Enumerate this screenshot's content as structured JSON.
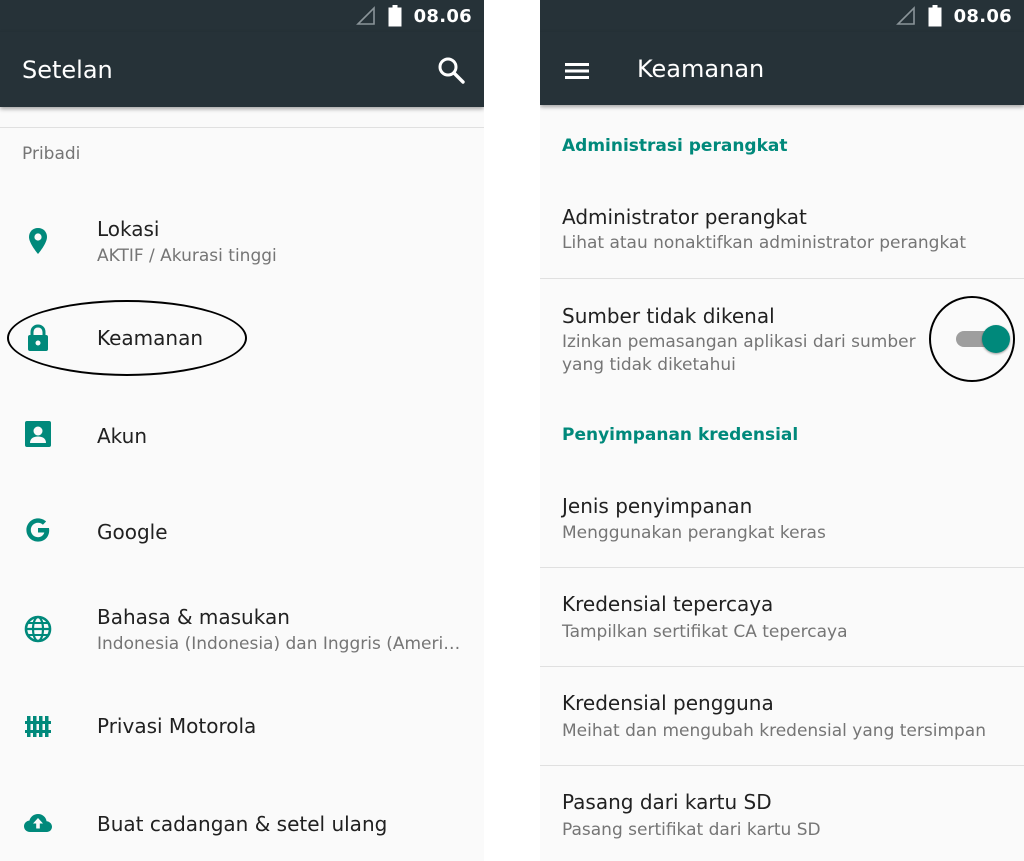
{
  "status_bar": {
    "time": "08.06",
    "icons": [
      "signal-icon",
      "battery-icon"
    ]
  },
  "left": {
    "title": "Setelan",
    "section_header": "Pribadi",
    "items": [
      {
        "icon": "location-icon",
        "title": "Lokasi",
        "subtitle": "AKTIF / Akurasi tinggi"
      },
      {
        "icon": "lock-icon",
        "title": "Keamanan"
      },
      {
        "icon": "account-icon",
        "title": "Akun"
      },
      {
        "icon": "google-icon",
        "title": "Google"
      },
      {
        "icon": "globe-icon",
        "title": "Bahasa & masukan",
        "subtitle": "Indonesia (Indonesia) dan Inggris (Amerika Serikat)"
      },
      {
        "icon": "fence-icon",
        "title": "Privasi Motorola"
      },
      {
        "icon": "cloud-upload-icon",
        "title": "Buat cadangan & setel ulang"
      }
    ]
  },
  "right": {
    "title": "Keamanan",
    "sections": [
      {
        "header": "Administrasi perangkat"
      },
      {
        "header": "Penyimpanan kredensial"
      }
    ],
    "items": [
      {
        "title": "Administrator perangkat",
        "subtitle": "Lihat atau nonaktifkan administrator perangkat"
      },
      {
        "title": "Sumber tidak dikenal",
        "subtitle": "Izinkan pemasangan aplikasi dari sumber yang tidak diketahui",
        "toggle_on": true
      },
      {
        "title": "Jenis penyimpanan",
        "subtitle": "Menggunakan perangkat keras"
      },
      {
        "title": "Kredensial tepercaya",
        "subtitle": "Tampilkan sertifikat CA tepercaya"
      },
      {
        "title": "Kredensial pengguna",
        "subtitle": "Meihat dan mengubah kredensial yang tersimpan"
      },
      {
        "title": "Pasang dari kartu SD",
        "subtitle": "Pasang sertifikat dari kartu SD"
      }
    ]
  },
  "colors": {
    "appbar": "#263238",
    "accent": "#00897b",
    "background": "#fafafa"
  }
}
